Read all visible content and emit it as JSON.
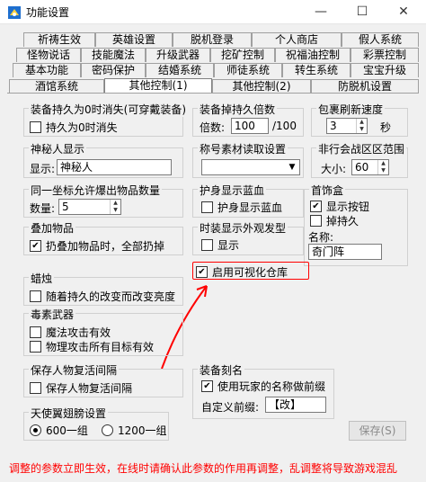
{
  "window": {
    "title": "功能设置",
    "min_glyph": "—",
    "max_glyph": "☐",
    "close_glyph": "✕"
  },
  "tabs": {
    "row1": [
      "祈祷生效",
      "英雄设置",
      "脱机登录",
      "个人商店",
      "假人系统"
    ],
    "row2": [
      "怪物说话",
      "技能魔法",
      "升级武器",
      "挖矿控制",
      "祝福油控制",
      "彩票控制"
    ],
    "row3": [
      "基本功能",
      "密码保护",
      "结婚系统",
      "师徒系统",
      "转生系统",
      "宝宝升级"
    ],
    "row4": [
      "酒馆系统",
      "其他控制(1)",
      "其他控制(2)",
      "防脱机设置"
    ],
    "active": "其他控制(1)"
  },
  "groups": {
    "durability": {
      "legend": "装备持久为0时消失(可穿戴装备)",
      "checkbox": "持久为0时消失",
      "checked": false
    },
    "drop_durability": {
      "legend": "装备掉持久倍数",
      "label": "倍数:",
      "value": "100",
      "suffix": "/100"
    },
    "bag_refresh": {
      "legend": "包裹刷新速度",
      "value": "3",
      "suffix": "秒"
    },
    "mystery": {
      "legend": "神秘人显示",
      "label": "显示:",
      "value": "神秘人"
    },
    "title_read": {
      "legend": "称号素材读取设置",
      "value": ""
    },
    "guild_range": {
      "legend": "非行会战区区范围",
      "label": "大小:",
      "value": "60"
    },
    "drop_count": {
      "legend": "同一坐标允许爆出物品数量",
      "label": "数量:",
      "value": "5"
    },
    "protect_mp": {
      "legend": "护身显示蓝血",
      "checkbox": "护身显示蓝血",
      "checked": false
    },
    "jewelry_box": {
      "legend": "首饰盒",
      "show_button": "显示按钮",
      "show_button_checked": true,
      "durability": "掉持久",
      "durability_checked": false,
      "name_label": "名称:",
      "name_value": "奇门阵"
    },
    "stack": {
      "legend": "叠加物品",
      "checkbox": "扔叠加物品时，全部扔掉",
      "checked": true
    },
    "fashion_hair": {
      "legend": "时装显示外观发型",
      "checkbox": "显示",
      "checked": false
    },
    "visual_storage": {
      "checkbox": "启用可视化仓库",
      "checked": true
    },
    "candle": {
      "legend": "蜡烛",
      "checkbox": "随着持久的改变而改变亮度",
      "checked": false
    },
    "poison_weapon": {
      "legend": "毒素武器",
      "magic": "魔法攻击有效",
      "magic_checked": false,
      "physical": "物理攻击所有目标有效",
      "physical_checked": false
    },
    "revive": {
      "legend": "保存人物复活间隔",
      "checkbox": "保存人物复活间隔",
      "checked": false
    },
    "engrave": {
      "legend": "装备刻名",
      "checkbox": "使用玩家的名称做前缀",
      "checked": true,
      "prefix_label": "自定义前缀:",
      "prefix_value": "【改】"
    },
    "wings": {
      "legend": "天使翼翅膀设置",
      "option1": "600一组",
      "option2": "1200一组",
      "selected": "600一组"
    }
  },
  "save_button": "保存(S)",
  "footer_note": "调整的参数立即生效，在线时请确认此参数的作用再调整，乱调整将导致游戏混乱",
  "colors": {
    "annotation": "#ff0000",
    "window_bg": "#f0f0f0"
  }
}
